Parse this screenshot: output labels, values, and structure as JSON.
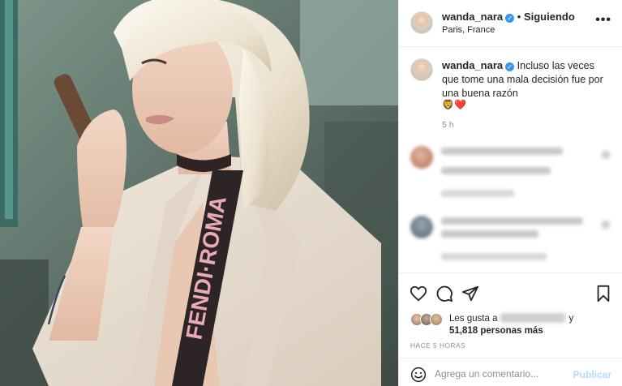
{
  "post": {
    "username": "wanda_nara",
    "verified_glyph": "✓",
    "separator": " • ",
    "follow_label": "Siguiendo",
    "location": "Paris, France",
    "more_label": "•••",
    "caption_text": "Incluso las veces que tome una mala decisión fue por una buena razón",
    "caption_emoji": "🦁❤️",
    "caption_age": "5 h",
    "likes_prefix": "Les gusta a",
    "likes_suffix": "y",
    "likes_count": "51,818 personas más",
    "posted_ago": "HACE 5 HORAS",
    "comment_placeholder": "Agrega un comentario...",
    "publish_label": "Publicar"
  },
  "icons": {
    "like": "heart-icon",
    "comment": "comment-bubble-icon",
    "share": "paper-plane-icon",
    "save": "bookmark-icon",
    "emoji": "smiley-icon",
    "more": "ellipsis-icon",
    "verified": "verified-badge-icon"
  },
  "colors": {
    "verified_blue": "#3897f0",
    "publish_disabled": "#b3dbff",
    "muted_text": "#8e8e8e",
    "divider": "#efefef"
  }
}
